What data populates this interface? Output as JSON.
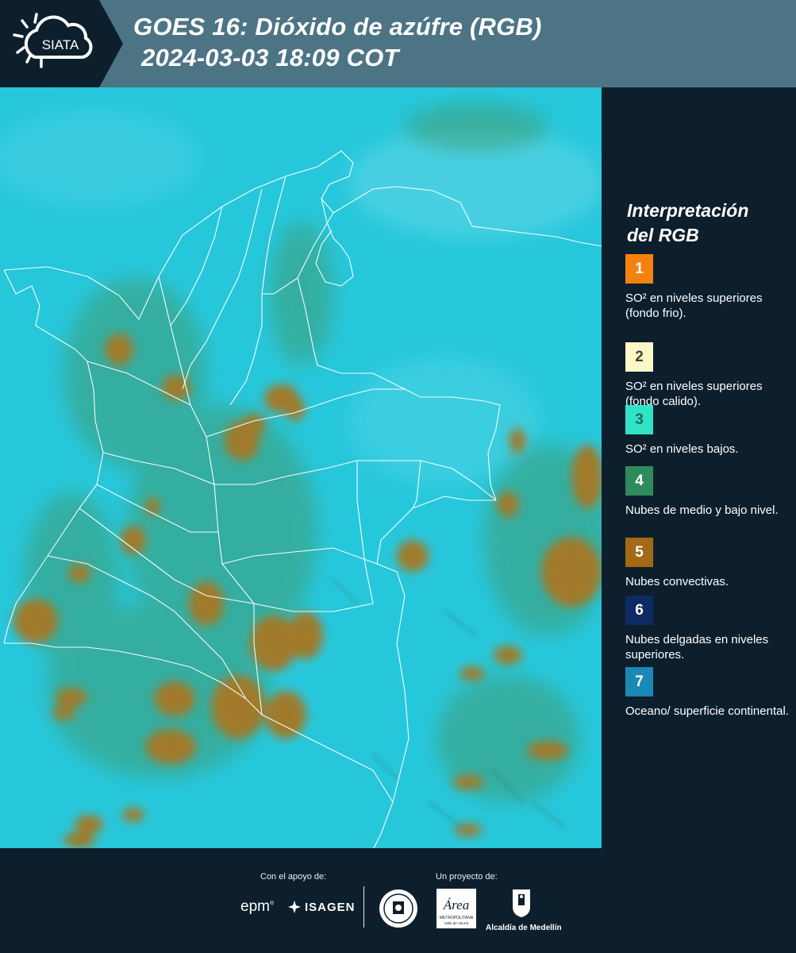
{
  "header": {
    "logo_text": "SIATA",
    "title_line1": "GOES 16: Dióxido de azúfre (RGB)",
    "title_line2": "2024-03-03 18:09 COT",
    "background_color": "#4d7484"
  },
  "legend": {
    "title_line1": "Interpretación",
    "title_line2": "del RGB",
    "items": [
      {
        "number": "1",
        "text": "SO² en niveles superiores (fondo frio).",
        "color": "#f5820f",
        "number_color": "#ffffff"
      },
      {
        "number": "2",
        "text": "SO² en niveles superiores (fondo calido).",
        "color": "#fdf6c6",
        "number_color": "#444444"
      },
      {
        "number": "3",
        "text": "SO² en niveles bajos.",
        "color": "#2fe3c7",
        "number_color": "#1f6b62"
      },
      {
        "number": "4",
        "text": "Nubes de medio y bajo nivel.",
        "color": "#2f8a5c",
        "number_color": "#ffffff"
      },
      {
        "number": "5",
        "text": "Nubes convectivas.",
        "color": "#a36a16",
        "number_color": "#ffffff"
      },
      {
        "number": "6",
        "text": "Nubes delgadas en niveles superiores.",
        "color": "#0e2a63",
        "number_color": "#ffffff"
      },
      {
        "number": "7",
        "text": "Oceano/ superficie continental.",
        "color": "#1b89b5",
        "number_color": "#ffffff"
      }
    ]
  },
  "map": {
    "background_color": "#27c7db",
    "convective_cloud_color": "#a07a2c",
    "mid_cloud_color": "#3f9b72",
    "border_color": "#ffffff"
  },
  "footer": {
    "support_label": "Con el apoyo de:",
    "project_label": "Un proyecto de:",
    "sponsors": [
      "epm",
      "ISAGEN"
    ],
    "area_logo_text": "Área",
    "area_logo_subtext": "METROPOLITANA",
    "area_logo_subtext2": "Valle de Aburrá",
    "alcaldia_text": "Alcaldía de Medellín"
  }
}
